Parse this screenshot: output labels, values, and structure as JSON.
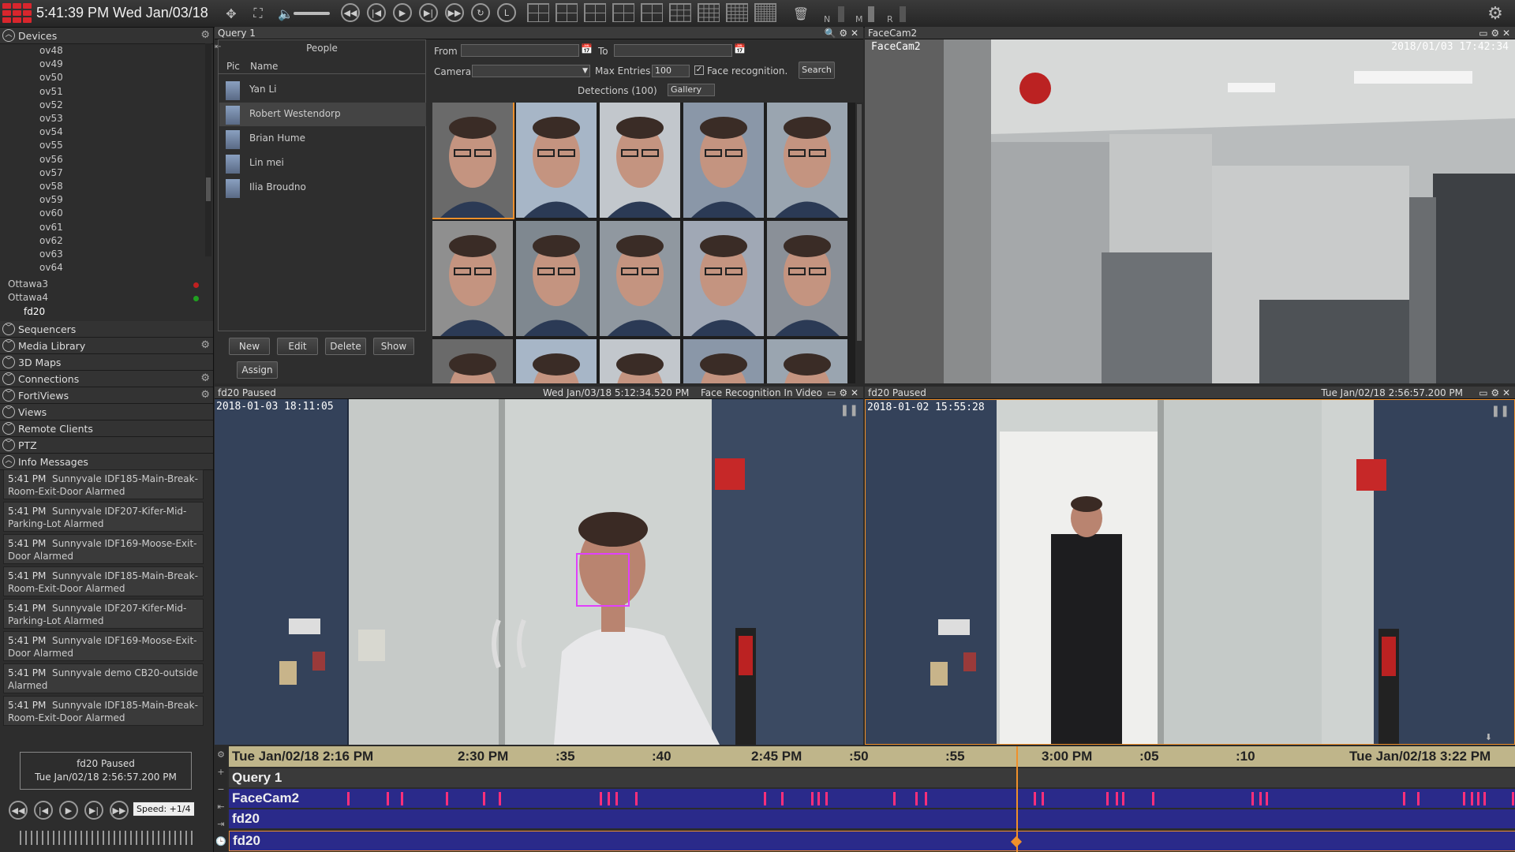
{
  "topbar": {
    "clock": "5:41:39 PM Wed Jan/03/18",
    "grid_labels": [
      "N",
      "M",
      "R"
    ]
  },
  "left": {
    "devices_label": "Devices",
    "devices": [
      "ov48",
      "ov49",
      "ov50",
      "ov51",
      "ov52",
      "ov53",
      "ov54",
      "ov55",
      "ov56",
      "ov57",
      "ov58",
      "ov59",
      "ov60",
      "ov61",
      "ov62",
      "ov63",
      "ov64"
    ],
    "ottawa3": "Ottawa3",
    "ottawa4": "Ottawa4",
    "fd20": "fd20",
    "sections": [
      "Sequencers",
      "Media Library",
      "3D Maps",
      "Connections",
      "FortiViews",
      "Views",
      "Remote Clients",
      "PTZ",
      "Info Messages"
    ],
    "messages": [
      {
        "time": "5:41 PM",
        "text": "Sunnyvale IDF185-Main-Break-Room-Exit-Door Alarmed"
      },
      {
        "time": "5:41 PM",
        "text": "Sunnyvale IDF207-Kifer-Mid-Parking-Lot Alarmed"
      },
      {
        "time": "5:41 PM",
        "text": "Sunnyvale IDF169-Moose-Exit-Door Alarmed"
      },
      {
        "time": "5:41 PM",
        "text": "Sunnyvale IDF185-Main-Break-Room-Exit-Door Alarmed"
      },
      {
        "time": "5:41 PM",
        "text": "Sunnyvale IDF207-Kifer-Mid-Parking-Lot Alarmed"
      },
      {
        "time": "5:41 PM",
        "text": "Sunnyvale IDF169-Moose-Exit-Door Alarmed"
      },
      {
        "time": "5:41 PM",
        "text": "Sunnyvale demo CB20-outside Alarmed"
      },
      {
        "time": "5:41 PM",
        "text": "Sunnyvale IDF185-Main-Break-Room-Exit-Door Alarmed"
      }
    ],
    "status_line1": "fd20 Paused",
    "status_line2": "Tue Jan/02/18 2:56:57.200 PM",
    "speed": "Speed: +1/4"
  },
  "query": {
    "title": "Query 1",
    "people_header": "People",
    "col_pic": "Pic",
    "col_name": "Name",
    "people": [
      "Yan Li",
      "Robert Westendorp",
      "Brian Hume",
      "Lin mei",
      "Ilia Broudno"
    ],
    "from_label": "From",
    "to_label": "To",
    "camera_label": "Camera",
    "max_entries_label": "Max Entries",
    "max_entries_value": "100",
    "face_recognition_label": "Face recognition.",
    "search_label": "Search",
    "detections_label": "Detections (100)",
    "gallery_label": "Gallery",
    "btn_new": "New",
    "btn_edit": "Edit",
    "btn_delete": "Delete",
    "btn_show": "Show",
    "btn_assign": "Assign"
  },
  "facecam": {
    "title": "FaceCam2",
    "overlay_name": "FaceCam2",
    "timestamp": "2018/01/03 17:42:34"
  },
  "video1": {
    "title": "fd20 Paused",
    "time": "Wed Jan/03/18 5:12:34.520 PM",
    "mode": "Face Recognition In Video",
    "timestamp": "2018-01-03 18:11:05"
  },
  "video2": {
    "title": "fd20 Paused",
    "time": "Tue Jan/02/18 2:56:57.200 PM",
    "timestamp": "2018-01-02 15:55:28"
  },
  "timeline": {
    "ticks": [
      "Tue Jan/02/18 2:16 PM",
      "2:30 PM",
      ":35",
      ":40",
      "2:45 PM",
      ":50",
      ":55",
      "3:00 PM",
      ":05",
      ":10",
      "Tue Jan/02/18 3:22 PM"
    ],
    "rows": [
      "Query 1",
      "FaceCam2",
      "fd20",
      "fd20"
    ],
    "colors": {
      "track": "#2a2a8a",
      "marker": "#ff2f7a",
      "cursor": "#f0902a",
      "ruler": "#bfb58a"
    }
  }
}
